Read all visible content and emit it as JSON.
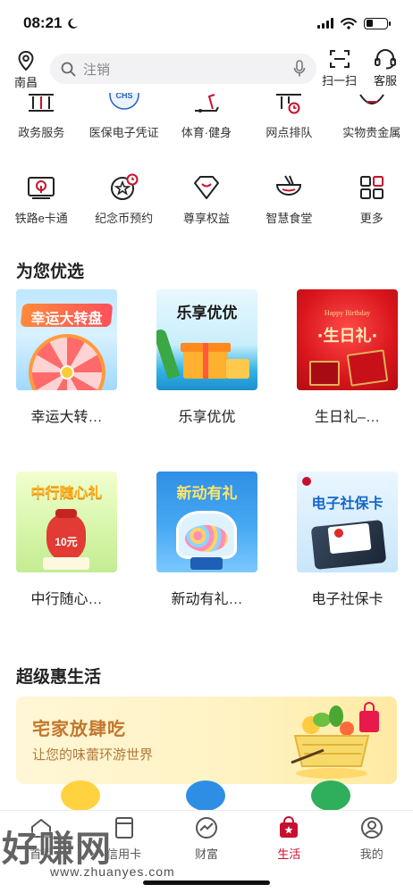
{
  "status_bar": {
    "time": "08:21"
  },
  "header": {
    "location": "南昌",
    "search_placeholder": "注销",
    "scan_label": "扫一扫",
    "service_label": "客服"
  },
  "services_row1": [
    {
      "label": "政务服务",
      "icon": "government-building-icon"
    },
    {
      "label": "医保电子凭证",
      "icon": "chs-medical-insurance-icon",
      "badge": "CHS"
    },
    {
      "label": "体育·健身",
      "icon": "treadmill-icon"
    },
    {
      "label": "网点排队",
      "icon": "branch-queue-icon"
    },
    {
      "label": "实物贵金属",
      "icon": "precious-metal-icon"
    }
  ],
  "services_row2": [
    {
      "label": "铁路e卡通",
      "icon": "railway-card-icon"
    },
    {
      "label": "纪念币预约",
      "icon": "commemorative-coin-icon"
    },
    {
      "label": "尊享权益",
      "icon": "diamond-icon"
    },
    {
      "label": "智慧食堂",
      "icon": "canteen-bowl-icon"
    },
    {
      "label": "更多",
      "icon": "more-grid-icon"
    }
  ],
  "recommend": {
    "title": "为您优选",
    "cards": [
      {
        "caption": "幸运大转…",
        "art_text": "幸运大转盘"
      },
      {
        "caption": "乐享优优",
        "art_text": "乐享优优"
      },
      {
        "caption": "生日礼–…",
        "art_text": "·生日礼·"
      },
      {
        "caption": "中行随心…",
        "art_text": "中行随心礼",
        "art_sub": "10元"
      },
      {
        "caption": "新动有礼…",
        "art_text": "新动有礼"
      },
      {
        "caption": "电子社保卡",
        "art_text": "电子社保卡"
      }
    ]
  },
  "life": {
    "title": "超级惠生活",
    "banner_title": "宅家放肆吃",
    "banner_subtitle": "让您的味蕾环游世界"
  },
  "tabbar": {
    "items": [
      {
        "label": "首页",
        "icon": "home-icon",
        "active": false
      },
      {
        "label": "信用卡",
        "icon": "credit-card-icon",
        "active": false
      },
      {
        "label": "财富",
        "icon": "wealth-chart-icon",
        "active": false
      },
      {
        "label": "生活",
        "icon": "life-bag-icon",
        "active": true
      },
      {
        "label": "我的",
        "icon": "profile-icon",
        "active": false
      }
    ]
  },
  "watermark": {
    "text": "好赚网",
    "url": "www.zhuanyes.com"
  },
  "colors": {
    "accent": "#c8102e",
    "banner_text": "#c2772c"
  }
}
